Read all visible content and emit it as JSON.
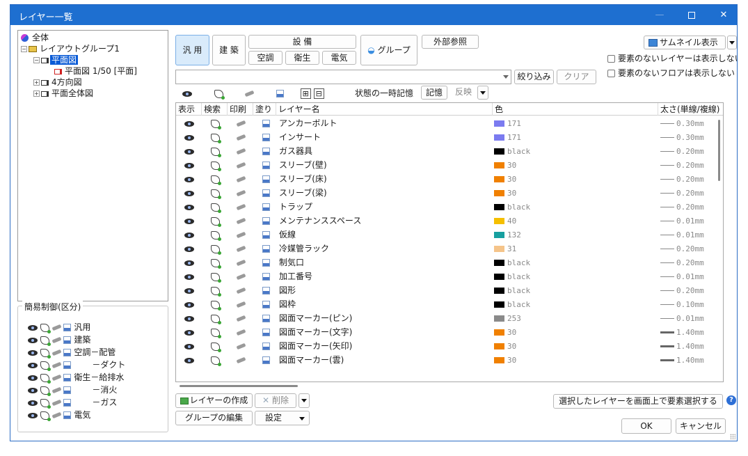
{
  "window": {
    "title": "レイヤー一覧"
  },
  "tree": {
    "root": "全体",
    "group": "レイアウトグループ1",
    "items": [
      "平面図",
      "平面図 1/50 [平面]",
      "4方向図",
      "平面全体図"
    ]
  },
  "simple_control": {
    "title": "簡易制御(区分)",
    "rows": [
      "汎用",
      "建築",
      "空調－配管",
      "－ダクト",
      "衛生－給排水",
      "－消火",
      "－ガス",
      "電気"
    ]
  },
  "tabs": {
    "general": "汎 用",
    "architecture": "建 築",
    "equipment": "設 備",
    "hvac": "空調",
    "sanitary": "衛生",
    "electric": "電気",
    "group": "グループ",
    "external_ref": "外部参照"
  },
  "right_panel": {
    "thumbnail": "サムネイル表示",
    "hide_empty_layers": "要素のないレイヤーは表示しない",
    "hide_empty_floors": "要素のないフロアは表示しない"
  },
  "filter": {
    "value": "",
    "narrow": "絞り込み",
    "clear": "クリア"
  },
  "toolbar": {
    "expand": "⊞",
    "collapse": "⊟",
    "state_memory_label": "状態の一時記憶",
    "memory": "記憶",
    "apply": "反映"
  },
  "table": {
    "headers": [
      "表示",
      "検索",
      "印刷",
      "塗り",
      "レイヤー名",
      "色",
      "太さ(単線/複線)"
    ],
    "rows": [
      {
        "name": "アンカーボルト",
        "color": "#7b7bf0",
        "color_label": "171",
        "width": "0.30mm",
        "thick": false
      },
      {
        "name": "インサート",
        "color": "#7b7bf0",
        "color_label": "171",
        "width": "0.30mm",
        "thick": false
      },
      {
        "name": "ガス器具",
        "color": "#000000",
        "color_label": "black",
        "width": "0.20mm",
        "thick": false
      },
      {
        "name": "スリーブ(壁)",
        "color": "#f08000",
        "color_label": "30",
        "width": "0.20mm",
        "thick": false
      },
      {
        "name": "スリーブ(床)",
        "color": "#f08000",
        "color_label": "30",
        "width": "0.20mm",
        "thick": false
      },
      {
        "name": "スリーブ(梁)",
        "color": "#f08000",
        "color_label": "30",
        "width": "0.20mm",
        "thick": false
      },
      {
        "name": "トラップ",
        "color": "#000000",
        "color_label": "black",
        "width": "0.20mm",
        "thick": false
      },
      {
        "name": "メンテナンススペース",
        "color": "#f5bf00",
        "color_label": "40",
        "width": "0.01mm",
        "thick": false
      },
      {
        "name": "仮線",
        "color": "#17a0a0",
        "color_label": "132",
        "width": "0.01mm",
        "thick": false
      },
      {
        "name": "冷媒管ラック",
        "color": "#f5c48a",
        "color_label": "31",
        "width": "0.20mm",
        "thick": false
      },
      {
        "name": "制気口",
        "color": "#000000",
        "color_label": "black",
        "width": "0.20mm",
        "thick": false
      },
      {
        "name": "加工番号",
        "color": "#000000",
        "color_label": "black",
        "width": "0.01mm",
        "thick": false
      },
      {
        "name": "図形",
        "color": "#000000",
        "color_label": "black",
        "width": "0.20mm",
        "thick": false
      },
      {
        "name": "図枠",
        "color": "#000000",
        "color_label": "black",
        "width": "0.10mm",
        "thick": false
      },
      {
        "name": "図面マーカー(ピン)",
        "color": "#8a8a8a",
        "color_label": "253",
        "width": "0.01mm",
        "thick": false
      },
      {
        "name": "図面マーカー(文字)",
        "color": "#f08000",
        "color_label": "30",
        "width": "1.40mm",
        "thick": true
      },
      {
        "name": "図面マーカー(矢印)",
        "color": "#f08000",
        "color_label": "30",
        "width": "1.40mm",
        "thick": true
      },
      {
        "name": "図面マーカー(雲)",
        "color": "#f08000",
        "color_label": "30",
        "width": "1.40mm",
        "thick": true
      }
    ]
  },
  "bottom": {
    "create_layer": "レイヤーの作成",
    "delete": "削除",
    "edit_group": "グループの編集",
    "settings": "設定",
    "select_on_screen": "選択したレイヤーを画面上で要素選択する",
    "ok": "OK",
    "cancel": "キャンセル",
    "help": "?"
  },
  "colors": {
    "titlebar": "#1e6fd0",
    "selection": "#0a5bd6",
    "active_tab": "#d9ebfb"
  }
}
